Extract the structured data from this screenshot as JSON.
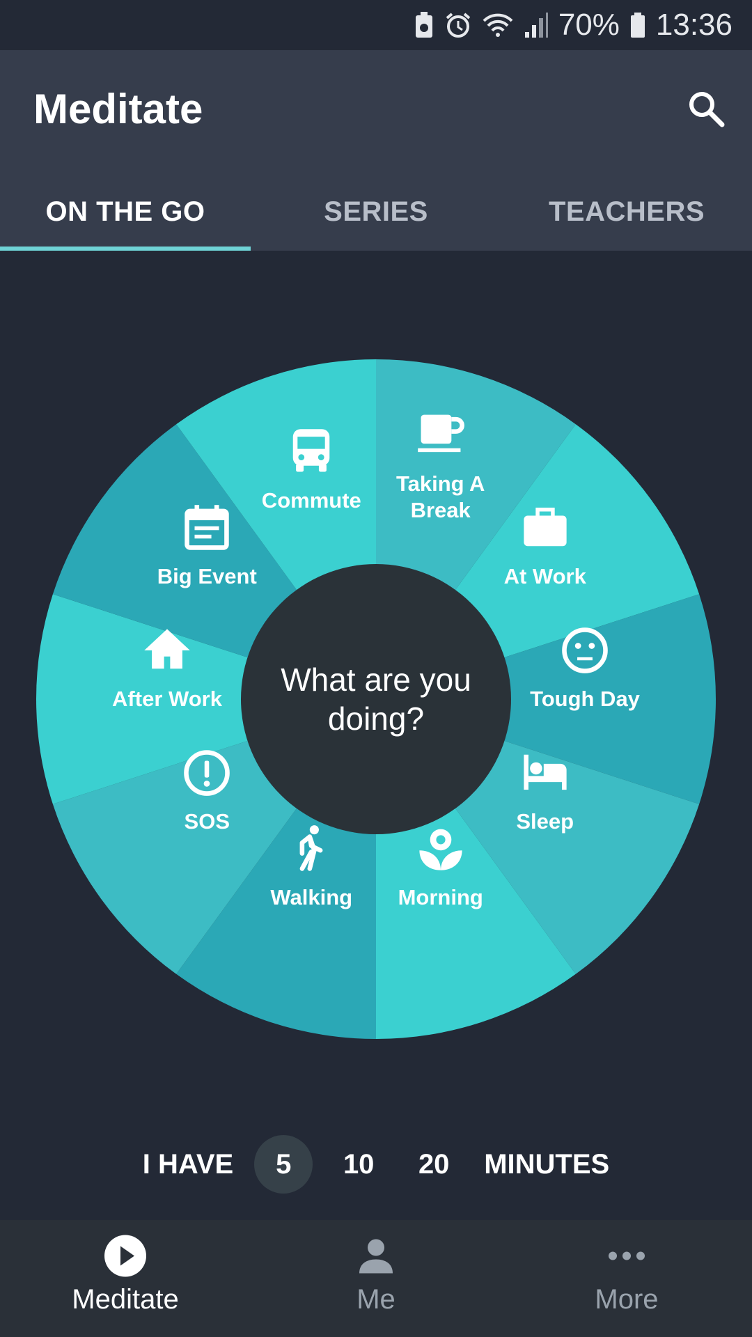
{
  "status_bar": {
    "battery": "70%",
    "time": "13:36"
  },
  "header": {
    "title": "Meditate"
  },
  "tabs": [
    {
      "label": "ON THE GO",
      "active": true
    },
    {
      "label": "SERIES",
      "active": false
    },
    {
      "label": "TEACHERS",
      "active": false
    }
  ],
  "wheel": {
    "center_text": "What are you doing?",
    "segments": [
      {
        "label": "Taking A Break",
        "icon": "coffee-cup-icon",
        "color": "#3dbcc4"
      },
      {
        "label": "At Work",
        "icon": "briefcase-icon",
        "color": "#3bd0d0"
      },
      {
        "label": "Tough Day",
        "icon": "neutral-face-icon",
        "color": "#2ba8b6"
      },
      {
        "label": "Sleep",
        "icon": "bed-icon",
        "color": "#3dbcc4"
      },
      {
        "label": "Morning",
        "icon": "flower-icon",
        "color": "#3bd0d0"
      },
      {
        "label": "Walking",
        "icon": "walking-person-icon",
        "color": "#2ba8b6"
      },
      {
        "label": "SOS",
        "icon": "alert-circle-icon",
        "color": "#3dbcc4"
      },
      {
        "label": "After Work",
        "icon": "home-icon",
        "color": "#3bd0d0"
      },
      {
        "label": "Big Event",
        "icon": "calendar-icon",
        "color": "#2ba8b6"
      },
      {
        "label": "Commute",
        "icon": "bus-icon",
        "color": "#3bd0d0"
      }
    ]
  },
  "minutes": {
    "prefix": "I HAVE",
    "options": [
      "5",
      "10",
      "20"
    ],
    "selected": "5",
    "suffix": "MINUTES"
  },
  "bottom_nav": [
    {
      "label": "Meditate",
      "icon": "play-circle-icon",
      "active": true
    },
    {
      "label": "Me",
      "icon": "person-icon",
      "active": false
    },
    {
      "label": "More",
      "icon": "more-dots-icon",
      "active": false
    }
  ],
  "colors": {
    "accent": "#6fd3d6",
    "background": "#232936",
    "appbar": "#363d4c",
    "center": "#2a3238"
  }
}
